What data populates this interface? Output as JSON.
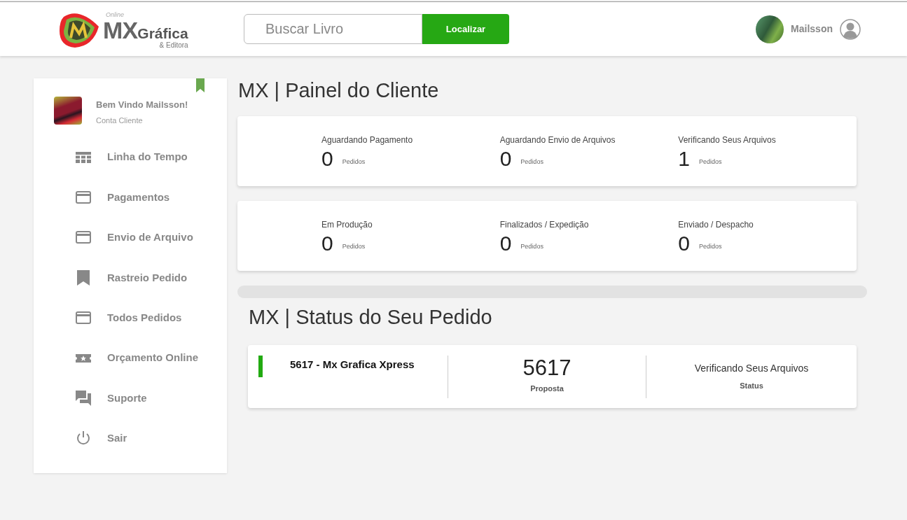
{
  "header": {
    "logo": {
      "small": "Online",
      "mark": "MX",
      "name": "Gráfica",
      "sub": "& Editora"
    },
    "search": {
      "placeholder": "Buscar Livro",
      "button": "Localizar"
    },
    "user": {
      "name": "Mailsson"
    }
  },
  "sidebar": {
    "greeting": "Bem Vindo Mailsson!",
    "role": "Conta Cliente",
    "items": [
      {
        "label": "Linha do Tempo",
        "kind": "table"
      },
      {
        "label": "Pagamentos",
        "kind": "card"
      },
      {
        "label": "Envio de Arquivo",
        "kind": "card"
      },
      {
        "label": "Rastreio Pedido",
        "kind": "bookmark"
      },
      {
        "label": "Todos Pedidos",
        "kind": "card"
      },
      {
        "label": "Orçamento Online",
        "kind": "ticket"
      },
      {
        "label": "Suporte",
        "kind": "chat"
      },
      {
        "label": "Sair",
        "kind": "power"
      }
    ]
  },
  "panel": {
    "title": "MX | Painel do Cliente",
    "rows": [
      [
        {
          "label": "Aguardando Pagamento",
          "count": "0",
          "unit": "Pedidos"
        },
        {
          "label": "Aguardando Envio de Arquivos",
          "count": "0",
          "unit": "Pedidos"
        },
        {
          "label": "Verificando Seus Arquivos",
          "count": "1",
          "unit": "Pedidos"
        }
      ],
      [
        {
          "label": "Em Produção",
          "count": "0",
          "unit": "Pedidos"
        },
        {
          "label": "Finalizados / Expedição",
          "count": "0",
          "unit": "Pedidos"
        },
        {
          "label": "Enviado / Despacho",
          "count": "0",
          "unit": "Pedidos"
        }
      ]
    ]
  },
  "orders": {
    "title": "MX | Status do Seu Pedido",
    "items": [
      {
        "name": "5617 - Mx Grafica Xpress",
        "color": "#22aa11",
        "number": "5617",
        "number_label": "Proposta",
        "status": "Verificando Seus Arquivos",
        "status_label": "Status"
      }
    ]
  }
}
